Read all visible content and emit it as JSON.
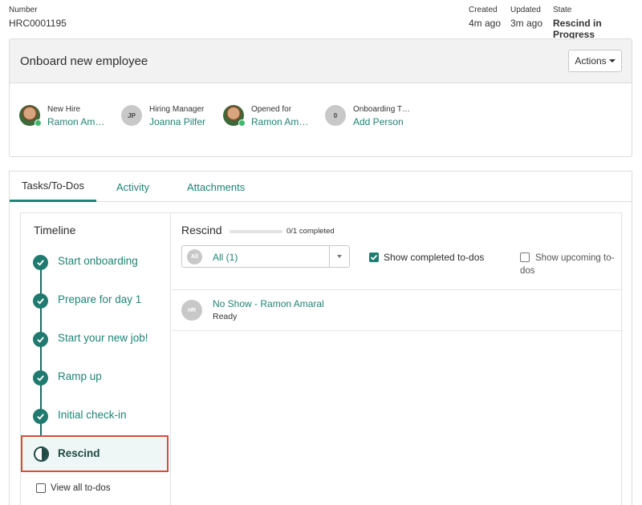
{
  "meta": {
    "number_label": "Number",
    "number_value": "HRC0001195",
    "created_label": "Created",
    "created_value": "4m ago",
    "updated_label": "Updated",
    "updated_value": "3m ago",
    "state_label": "State",
    "state_value": "Rescind in Progress"
  },
  "header": {
    "title": "Onboard new employee",
    "actions_label": "Actions"
  },
  "people": [
    {
      "role": "New Hire",
      "name": "Ramon Am…",
      "avatar": "photo"
    },
    {
      "role": "Hiring Manager",
      "name": "Joanna Pilfer",
      "initials": "JP"
    },
    {
      "role": "Opened for",
      "name": "Ramon Am…",
      "avatar": "photo"
    },
    {
      "role": "Onboarding T…",
      "name": "Add Person",
      "initials": "0"
    }
  ],
  "tabs": [
    {
      "label": "Tasks/To-Dos",
      "active": true
    },
    {
      "label": "Activity",
      "active": false
    },
    {
      "label": "Attachments",
      "active": false
    }
  ],
  "timeline": {
    "title": "Timeline",
    "steps": [
      {
        "label": "Start onboarding",
        "status": "complete"
      },
      {
        "label": "Prepare for day 1",
        "status": "complete"
      },
      {
        "label": "Start your new job!",
        "status": "complete"
      },
      {
        "label": "Ramp up",
        "status": "complete"
      },
      {
        "label": "Initial check-in",
        "status": "complete"
      },
      {
        "label": "Rescind",
        "status": "current"
      }
    ],
    "view_all_label": "View all to-dos"
  },
  "content": {
    "title": "Rescind",
    "progress_fraction": 0,
    "progress_text": "0/1 completed",
    "filter_badge": "All",
    "filter_value": "All (1)",
    "show_completed_label": "Show completed to-dos",
    "show_completed_checked": true,
    "show_upcoming_label": "Show upcoming to-dos",
    "show_upcoming_checked": false
  },
  "tasks": [
    {
      "initials": "HR",
      "name": "No Show - Ramon Amaral",
      "status": "Ready"
    }
  ],
  "colors": {
    "accent": "#1f8476",
    "highlight_border": "#e0483f",
    "online": "#3eb96b"
  }
}
